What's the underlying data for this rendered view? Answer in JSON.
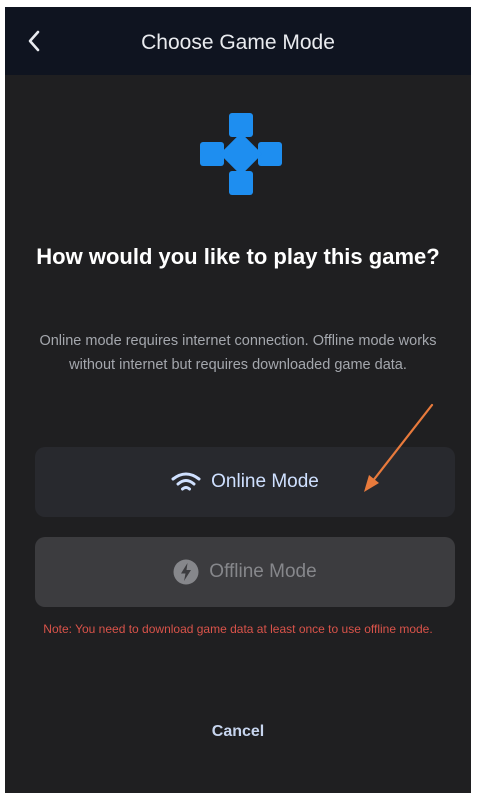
{
  "header": {
    "title": "Choose Game Mode"
  },
  "main": {
    "question": "How would you like to play this game?",
    "description": "Online mode requires internet connection. Offline mode works without internet but requires downloaded game data.",
    "online_button": {
      "label": "Online Mode",
      "icon": "wifi-icon"
    },
    "offline_button": {
      "label": "Offline Mode",
      "icon": "lightning-icon"
    },
    "note": "Note: You need to download game data at least once to use offline mode.",
    "cancel_label": "Cancel"
  },
  "colors": {
    "background": "#1f1f21",
    "header": "#0f1420",
    "accent_blue": "#1e8ef0",
    "note_red": "#d9534a",
    "arrow_orange": "#e87a3c"
  }
}
